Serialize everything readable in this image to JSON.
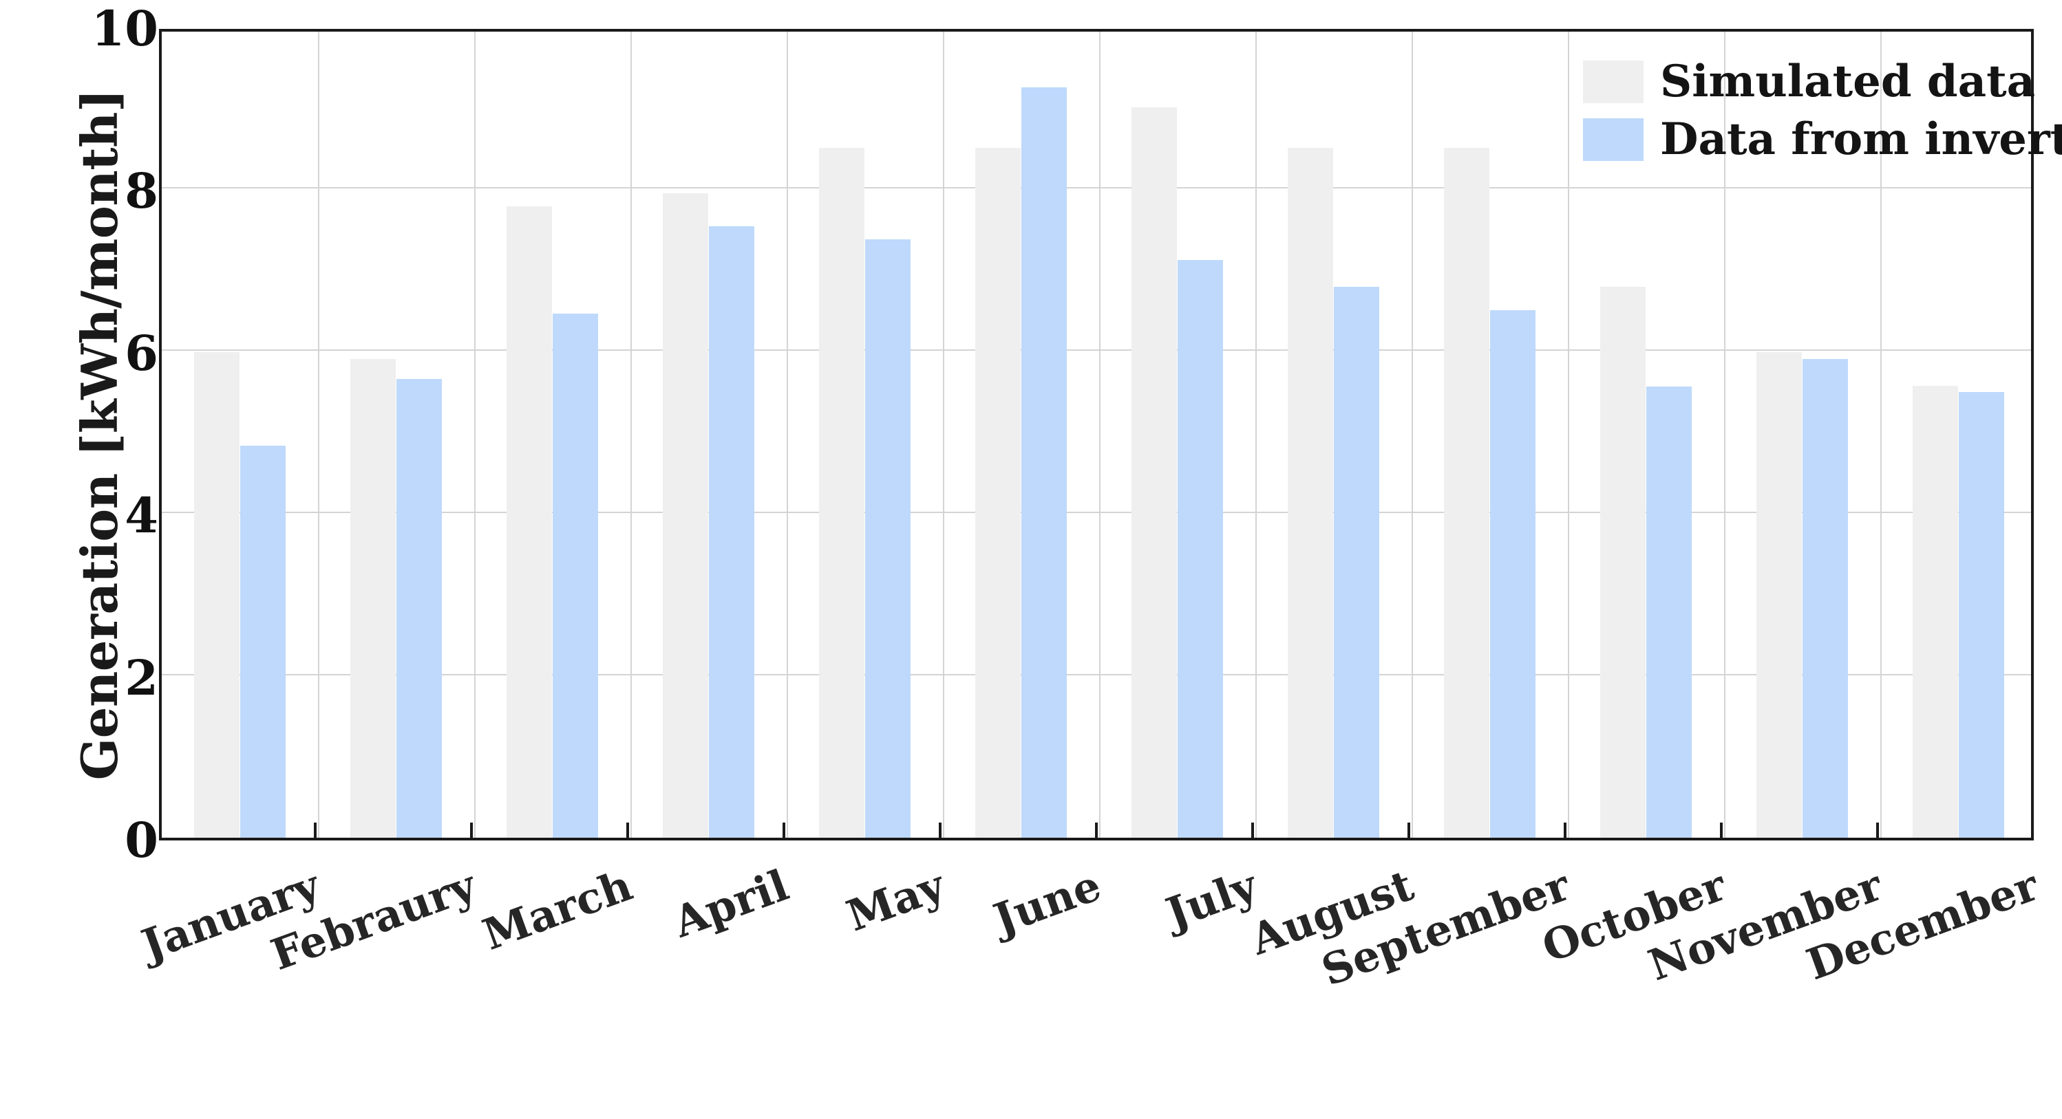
{
  "chart_data": {
    "type": "bar",
    "title": "",
    "xlabel": "",
    "ylabel": "Generation [kWh/month]",
    "ylim": [
      0,
      10
    ],
    "yticks": [
      0,
      2,
      4,
      6,
      8,
      10
    ],
    "ytick_labels": [
      "0",
      "2",
      "4",
      "6",
      "8",
      "10"
    ],
    "grid": "horizontal-and-vertical",
    "legend_position": "top-right",
    "categories": [
      "January",
      "Febraury",
      "March",
      "April",
      "May",
      "June",
      "July",
      "August",
      "September",
      "October",
      "November",
      "December"
    ],
    "series": [
      {
        "name": "Simulated data",
        "color": "#efefef",
        "values": [
          5.98,
          5.9,
          7.78,
          7.94,
          8.5,
          8.5,
          9.0,
          8.5,
          8.5,
          6.79,
          5.98,
          5.57
        ]
      },
      {
        "name": "Data from inverter",
        "color": "#bed9fb",
        "values": [
          4.83,
          5.65,
          6.46,
          7.53,
          7.37,
          9.25,
          7.12,
          6.79,
          6.5,
          5.56,
          5.9,
          5.49
        ]
      }
    ]
  },
  "legend": {
    "items": [
      {
        "label": "Simulated data",
        "color": "#efefef"
      },
      {
        "label": "Data from inverter",
        "color": "#bed9fb"
      }
    ]
  },
  "axes": {
    "y_title": "Generation [kWh/month]",
    "y_tick_labels": [
      "10",
      "8",
      "6",
      "4",
      "2",
      "0"
    ],
    "x_tick_labels": [
      "January",
      "Febraury",
      "March",
      "April",
      "May",
      "June",
      "July",
      "August",
      "September",
      "October",
      "November",
      "December"
    ]
  },
  "colors": {
    "simulated": "#efefef",
    "inverter": "#bed9fb",
    "axis": "#1a1a1a",
    "grid": "#d4d4d4",
    "background": "#ffffff"
  }
}
